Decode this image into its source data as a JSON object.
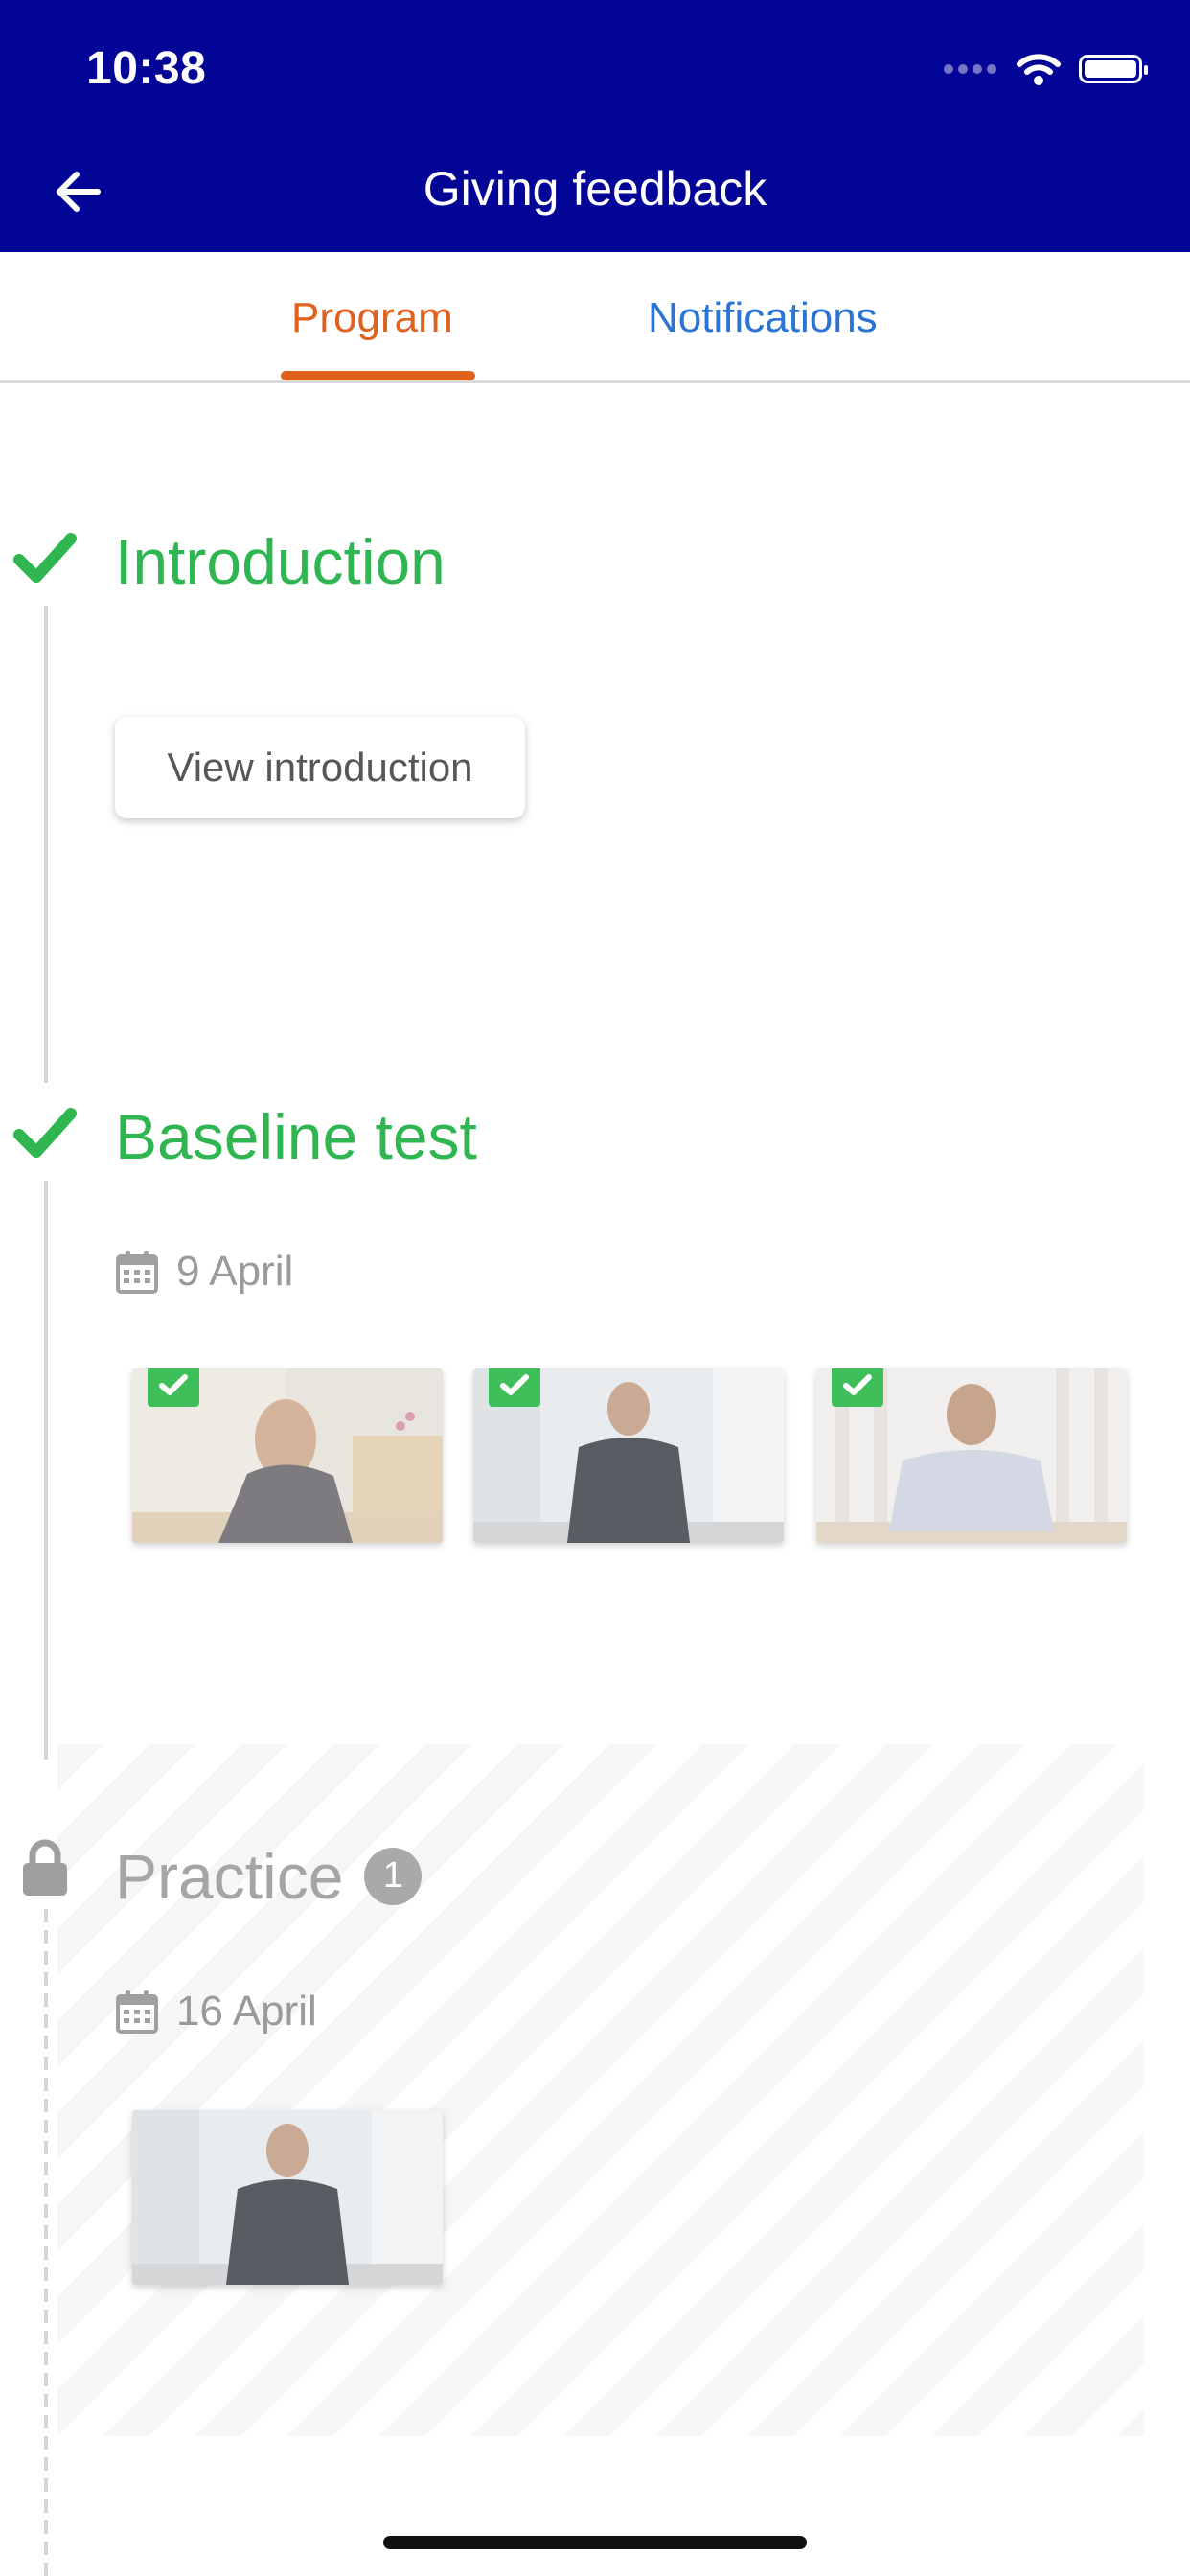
{
  "status_bar": {
    "time": "10:38"
  },
  "header": {
    "title": "Giving feedback"
  },
  "tabs": [
    {
      "label": "Program",
      "active": true
    },
    {
      "label": "Notifications",
      "active": false
    }
  ],
  "sections": {
    "introduction": {
      "title": "Introduction",
      "completed": true,
      "button_label": "View introduction"
    },
    "baseline": {
      "title": "Baseline test",
      "completed": true,
      "date": "9 April",
      "videos": [
        {
          "name": "woman-at-desk",
          "watched": true
        },
        {
          "name": "man-standing-suit",
          "watched": true
        },
        {
          "name": "man-seated-shirt",
          "watched": true
        }
      ]
    },
    "practice": {
      "title": "Practice",
      "locked": true,
      "badge_count": "1",
      "date": "16 April",
      "videos": [
        {
          "name": "man-standing-suit",
          "watched": false
        }
      ]
    }
  },
  "colors": {
    "header_bg": "#020596",
    "tab_active": "#e0601e",
    "tab_inactive": "#2b73d4",
    "completed_green": "#2fb650",
    "locked_gray": "#a5a5a5"
  }
}
